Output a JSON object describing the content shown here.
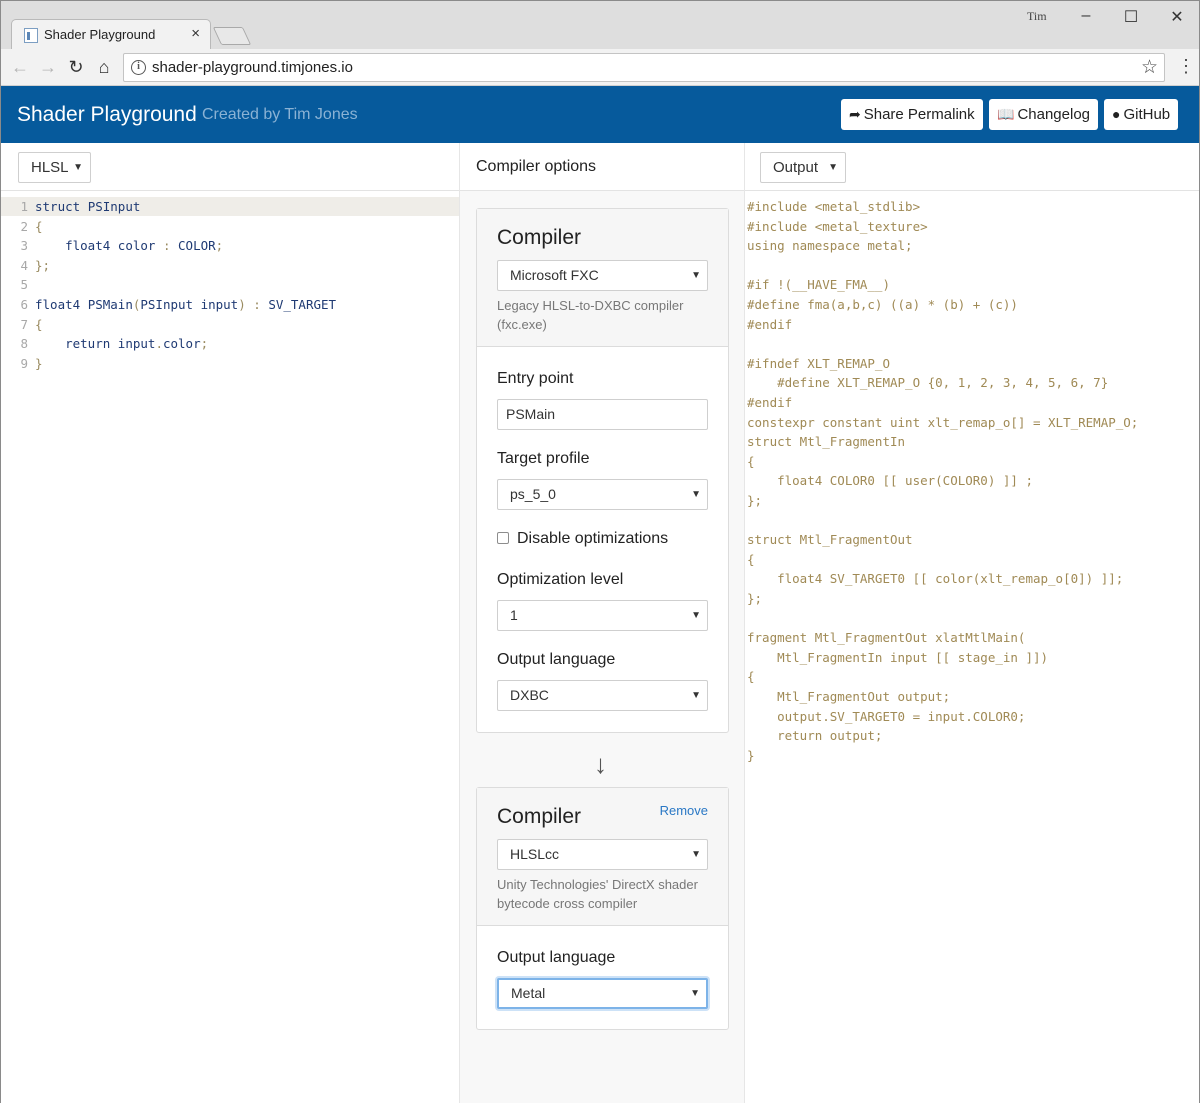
{
  "browser": {
    "tab_title": "Shader Playground",
    "tab_close": "×",
    "window_user": "Tim",
    "url": "shader-playground.timjones.io",
    "icons": [
      "back-icon",
      "forward-icon",
      "reload-icon",
      "home-icon",
      "info-icon",
      "star-icon",
      "menu-icon"
    ]
  },
  "header": {
    "title": "Shader Playground",
    "byline": "Created by Tim Jones",
    "share_label": "Share Permalink",
    "changelog_label": "Changelog",
    "github_label": "GitHub",
    "bg_color": "#065a9c"
  },
  "input": {
    "language": "HLSL",
    "lines": [
      {
        "num": "1",
        "tokens": [
          [
            "kw",
            "struct "
          ],
          [
            "id",
            "PSInput"
          ]
        ]
      },
      {
        "num": "2",
        "tokens": [
          [
            "punc",
            "{"
          ]
        ]
      },
      {
        "num": "3",
        "tokens": [
          [
            "kw",
            "    float4 "
          ],
          [
            "id",
            "color "
          ],
          [
            "punc",
            ": "
          ],
          [
            "id",
            "COLOR"
          ],
          [
            "punc",
            ";"
          ]
        ]
      },
      {
        "num": "4",
        "tokens": [
          [
            "punc",
            "};"
          ]
        ]
      },
      {
        "num": "5",
        "tokens": []
      },
      {
        "num": "6",
        "tokens": [
          [
            "kw",
            "float4 "
          ],
          [
            "id",
            "PSMain"
          ],
          [
            "punc",
            "("
          ],
          [
            "id",
            "PSInput input"
          ],
          [
            "punc",
            ") : "
          ],
          [
            "id",
            "SV_TARGET"
          ]
        ]
      },
      {
        "num": "7",
        "tokens": [
          [
            "punc",
            "{"
          ]
        ]
      },
      {
        "num": "8",
        "tokens": [
          [
            "kw",
            "    return "
          ],
          [
            "id",
            "input"
          ],
          [
            "punc",
            "."
          ],
          [
            "id",
            "color"
          ],
          [
            "punc",
            ";"
          ]
        ]
      },
      {
        "num": "9",
        "tokens": [
          [
            "punc",
            "}"
          ]
        ]
      }
    ]
  },
  "options": {
    "heading": "Compiler options",
    "stage1": {
      "title": "Compiler",
      "compiler": "Microsoft FXC",
      "description": "Legacy HLSL-to-DXBC compiler (fxc.exe)",
      "entry_point_label": "Entry point",
      "entry_point_value": "PSMain",
      "target_profile_label": "Target profile",
      "target_profile_value": "ps_5_0",
      "disable_opt_label": "Disable optimizations",
      "opt_level_label": "Optimization level",
      "opt_level_value": "1",
      "output_language_label": "Output language",
      "output_language_value": "DXBC"
    },
    "arrow": "↓",
    "stage2": {
      "title": "Compiler",
      "remove_label": "Remove",
      "compiler": "HLSLcc",
      "description": "Unity Technologies' DirectX shader bytecode cross compiler",
      "output_language_label": "Output language",
      "output_language_value": "Metal"
    }
  },
  "output": {
    "selector": "Output",
    "lines": [
      "#include <metal_stdlib>",
      "#include <metal_texture>",
      "using namespace metal;",
      "",
      "#if !(__HAVE_FMA__)",
      "#define fma(a,b,c) ((a) * (b) + (c))",
      "#endif",
      "",
      "#ifndef XLT_REMAP_O",
      "    #define XLT_REMAP_O {0, 1, 2, 3, 4, 5, 6, 7}",
      "#endif",
      "constexpr constant uint xlt_remap_o[] = XLT_REMAP_O;",
      "struct Mtl_FragmentIn",
      "{",
      "    float4 COLOR0 [[ user(COLOR0) ]] ;",
      "};",
      "",
      "struct Mtl_FragmentOut",
      "{",
      "    float4 SV_TARGET0 [[ color(xlt_remap_o[0]) ]];",
      "};",
      "",
      "fragment Mtl_FragmentOut xlatMtlMain(",
      "    Mtl_FragmentIn input [[ stage_in ]])",
      "{",
      "    Mtl_FragmentOut output;",
      "    output.SV_TARGET0 = input.COLOR0;",
      "    return output;",
      "}"
    ]
  }
}
